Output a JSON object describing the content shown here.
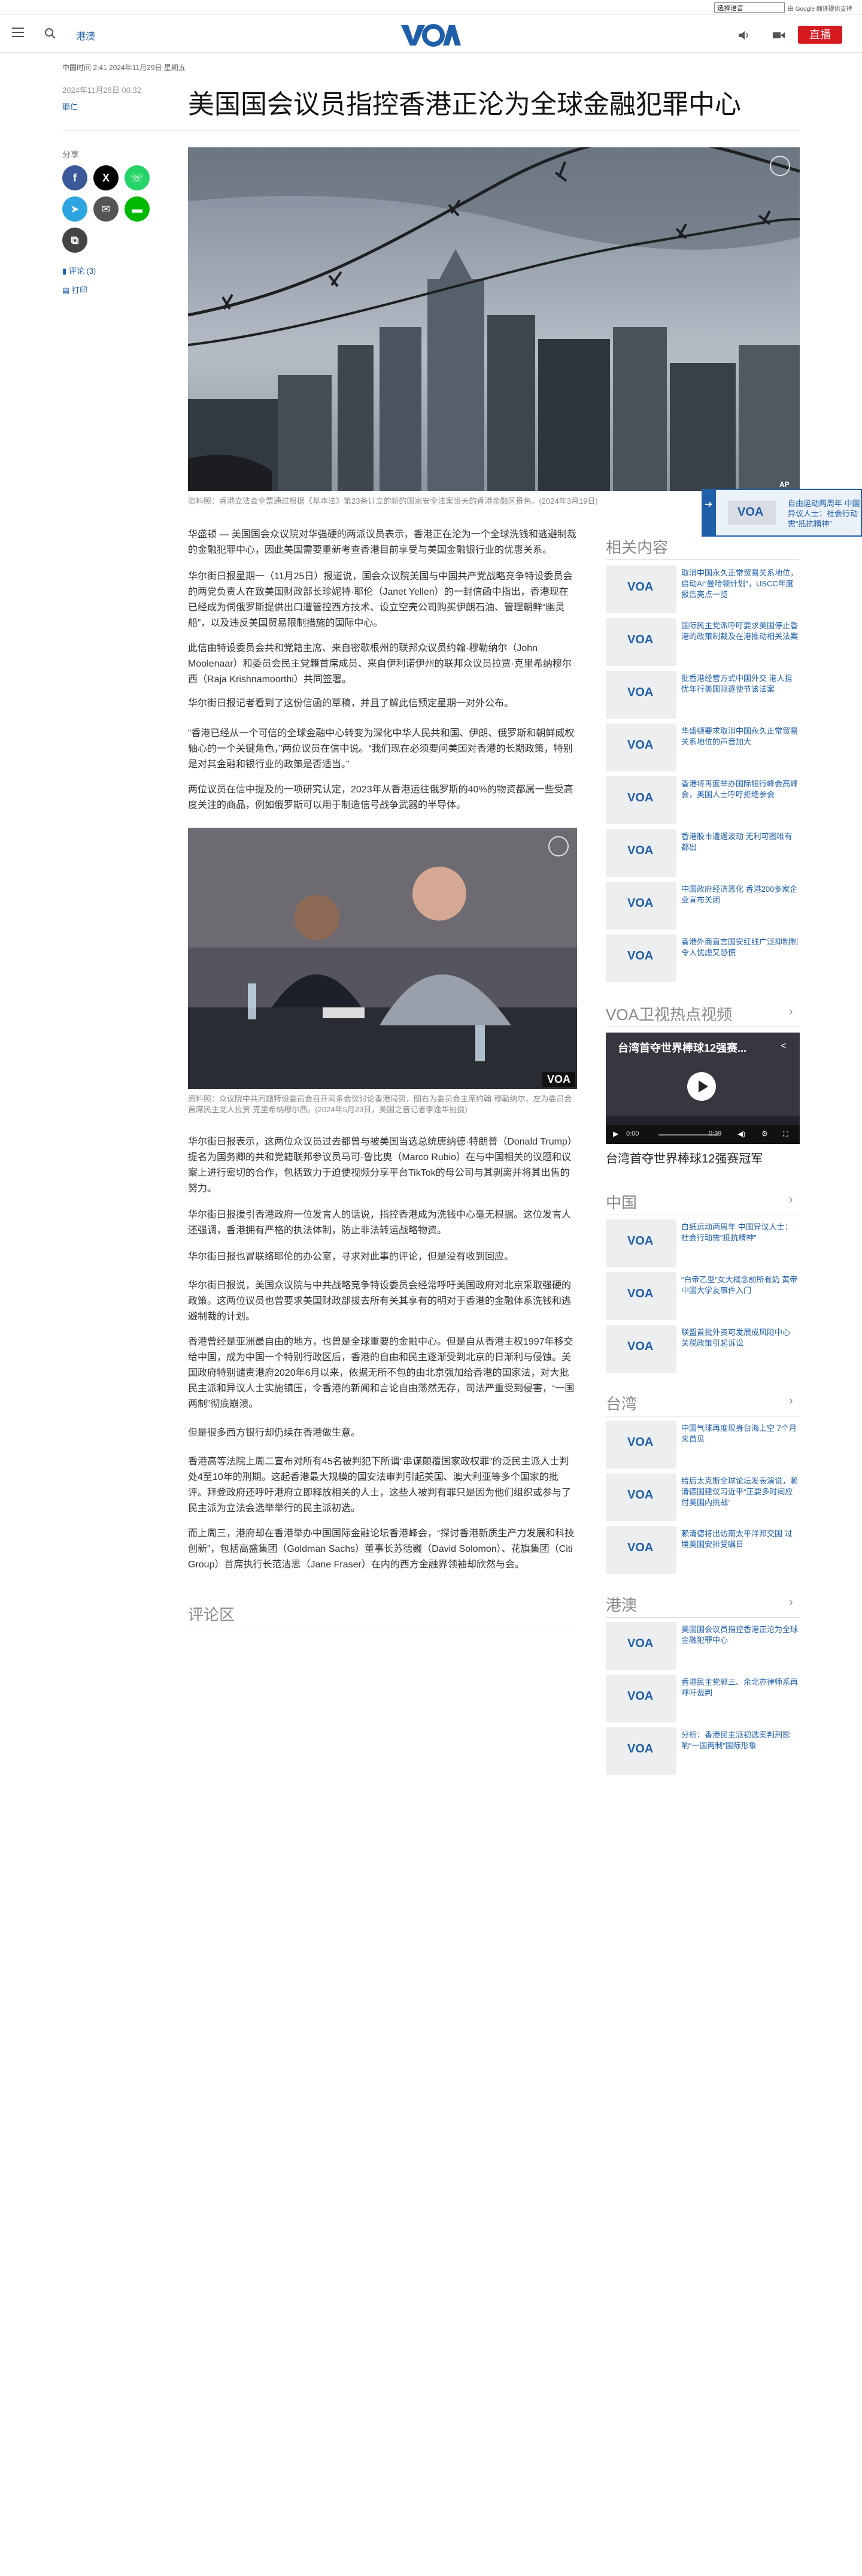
{
  "topbar": {
    "language": "选择语言",
    "powered_by": "由 Google 翻译提供支持"
  },
  "header": {
    "region": "港澳",
    "logo": "VOA",
    "live_label": "直播"
  },
  "article": {
    "meta_line": "中国时间 2:41 2024年11月29日 星期五",
    "date": "2024年11月28日 00:32",
    "author": "耶仁",
    "title": "美国国会议员指控香港正沦为全球金融犯罪中心",
    "share_label": "分享",
    "comments_link": "评论 (3)",
    "print_link": "打印",
    "hero_caption": "资料照：香港立法会全票通过根据《基本法》第23条订立的新的国家安全法案当天的香港金融区景色。(2024年3月19日)",
    "hero_ap": "AP",
    "inline_caption": "资料照：众议院中共问题特设委员会召开闻条会议讨论香港局势，图右为委员会主席约翰·穆勒纳尔，左为委员会首席民主党人拉贾·克里希纳穆尔西。(2024年5月23日，美国之音记者李逸华拍摄)",
    "inline_voa": "VOA",
    "paragraphs_a": [
      "华盛顿 — 美国国会众议院对华强硬的两派议员表示，香港正在沦为一个全球洗钱和逃避制裁的金融犯罪中心，因此美国需要重新考查香港目前享受与美国金融银行业的优惠关系。",
      "华尔街日报星期一（11月25日）报道说，国会众议院美国与中国共产党战略竞争特设委员会的两党负责人在致美国财政部长珍妮特·耶伦（Janet Yellen）的一封信函中指出，香港现在已经成为伺俄罗斯提供出口遭管控西方技术、设立空壳公司购买伊朗石油、管理朝鲜“幽灵船”，以及违反美国贸易限制措施的国际中心。",
      "此信由特设委员会共和党籍主席、来自密歇根州的联邦众议员约翰·穆勒纳尔（John Moolenaar）和委员会民主党籍首席成员、来自伊利诺伊州的联邦众议员拉贾·克里希纳穆尔西（Raja Krishnamoorthi）共同签署。",
      "华尔街日报记者看到了这份信函的草稿，并且了解此信预定星期一对外公布。",
      "“香港已经从一个可信的全球金融中心转变为深化中华人民共和国、伊朗、俄罗斯和朝鲜威权轴心的一个关键角色，”两位议员在信中说。“我们现在必须要问美国对香港的长期政策，特别是对其金融和银行业的政策是否适当。”",
      "两位议员在信中提及的一项研究认定，2023年从香港运往俄罗斯的40%的物资都属一些受高度关注的商品，例如俄罗斯可以用于制造信号战争武器的半导体。"
    ],
    "paragraphs_b": [
      "华尔街日报表示，这两位众议员过去都曾与被美国当选总统唐纳德·特朗普（Donald Trump）提名为国务卿的共和党籍联邦参议员马可·鲁比奥（Marco Rubio）在与中国相关的议题和议案上进行密切的合作，包括致力于迫使视频分享平台TikTok的母公司与其剥离并将其出售的努力。",
      "华尔街日报援引香港政府一位发言人的话说，指控香港成为洗钱中心毫无根据。这位发言人还强调，香港拥有严格的执法体制，防止非法转运战略物资。",
      "华尔街日报也冒联络耶伦的办公室，寻求对此事的评论，但是没有收到回应。",
      "华尔街日报说，美国众议院与中共战略竞争特设委员会经常呼吁美国政府对北京采取强硬的政策。这两位议员也曾要求美国财政部拔去所有关其享有的明对于香港的金融体系洗钱和逃避制裁的计划。",
      "香港曾经是亚洲最自由的地方，也曾是全球重要的金融中心。但是自从香港主权1997年移交给中国，成为中国一个特别行政区后，香港的自由和民主逐渐受到北京的日渐利与侵蚀。美国政府特别谴责港府2020年6月以来，依据无所不包的由北京强加给香港的国家法，对大批民主派和异议人士实施镇压，令香港的新闻和言论自由荡然无存，司法严重受到侵害，“一国两制”彻底崩溃。",
      "但是很多西方银行却仍续在香港做生意。",
      "香港高等法院上周二宣布对所有45名被判犯下所谓“串谋颠覆国家政权罪”的泛民主派人士判处4至10年的刑期。这起香港最大规模的国安法审判引起美国、澳大利亚等多个国家的批评。拜登政府还呼吁港府立即释放相关的人士，这些人被判有罪只是因为他们组织或参与了民主派为立法会选举举行的民主派初选。",
      "而上周三，港府却在香港举办中国国际金融论坛香港峰会，“探讨香港新质生产力发展和科技创新”，包括高盛集团（Goldman Sachs）董事长苏德巍（David Solomon）、花旗集团（Citi Group）首席执行长范洁思（Jane Fraser）在内的西方金融界领袖却欣然与会。"
    ],
    "comments_heading": "评论区"
  },
  "popup": {
    "text": "自由运动两周年 中国异议人士：社会行动需“抵抗精神”"
  },
  "related": {
    "heading": "相关内容",
    "items": [
      "取消中国永久正常贸易关系地位，启动AI“曼哈顿计划”，USCC年度报告亮点一览",
      "国际民主党派呼吁要求美国停止香港的政策制裁及在港推动相关法案",
      "批香港经营方式中国外交 港人担忧年行美国驱逐使节该法案",
      "华盛顿要求取消中国永久正常贸易关系地位的声音加大",
      "香港将再度举办国际银行峰会高峰会，美国人士呼吁拒绝参会",
      "香港股市遭遇波动 无利可图唯有都出",
      "中国政府经济恶化 香港200多家企业宣布关闭",
      "香港外商直言国安红线广泛抑制制 令人忧虑又恐慌"
    ]
  },
  "video": {
    "heading": "VOA卫视热点视频",
    "title_overlay": "台湾首夺世界棒球12强赛...",
    "time_now": "0:00",
    "time_total": "0:39",
    "caption": "台湾首夺世界棒球12强赛冠军"
  },
  "china": {
    "heading": "中国",
    "items": [
      "白纸运动两周年 中国异议人士：社会行动需“抵抗精神”",
      "“白帝乙型”女大概念前所有奶 黄帝中国大学友事件入门",
      "联盟首批外资可发展成风险中心 关税政策引起诉讼"
    ]
  },
  "taiwan": {
    "heading": "台湾",
    "items": [
      "中国气球再度现身台海上空 7个月来首见",
      "给后太克斯全球论坛发表演说，赖清德国建议习近平“正要多时间应付美国内挑战”",
      "赖清德将出访南太平洋邦交国 过境美国安排受瞩目"
    ]
  },
  "hongkong": {
    "heading": "港澳",
    "items": [
      "美国国会议员指控香港正沦为全球金融犯罪中心",
      "香港民主党郭三、余北亦律师系再呼吁裁判",
      "分析：香港民主派初选案判刑影响“一国两制”国际形象"
    ]
  }
}
